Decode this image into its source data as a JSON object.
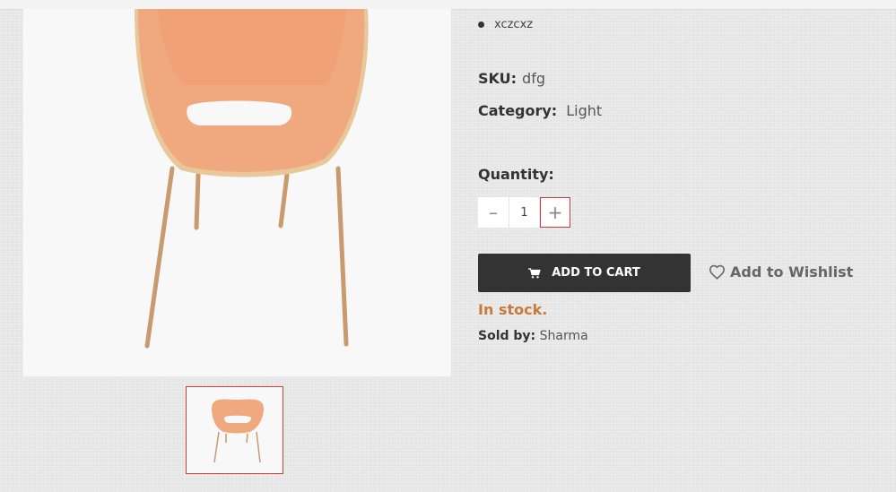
{
  "product": {
    "feature_bullets": [
      "xczcxz"
    ],
    "sku_label": "SKU:",
    "sku_value": "dfg",
    "category_label": "Category:",
    "category_value": "Light",
    "quantity_label": "Quantity:",
    "quantity_value": "1",
    "minus_symbol": "–",
    "plus_symbol": "+",
    "add_to_cart_label": "ADD TO CART",
    "wishlist_label": "Add to Wishlist",
    "stock_status": "In stock.",
    "sold_by_label": "Sold by:",
    "sold_by_value": "Sharma"
  },
  "icons": {
    "cart": "cart-icon",
    "wishlist": "heart-icon"
  },
  "colors": {
    "button_bg": "#333333",
    "stock": "#c97a3b",
    "active_border": "#d43a3a"
  }
}
